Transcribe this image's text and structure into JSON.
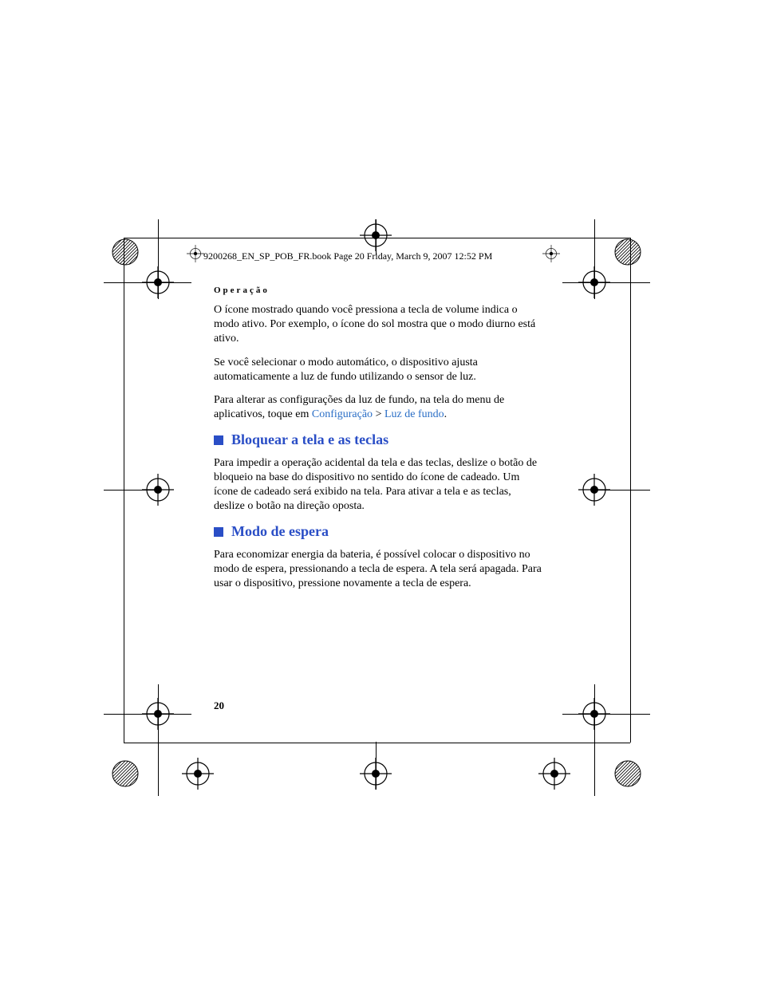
{
  "header_line": "9200268_EN_SP_POB_FR.book  Page 20  Friday, March 9, 2007  12:52 PM",
  "section_label": "Operação",
  "para1": "O ícone mostrado quando você pressiona a tecla de volume indica o modo ativo. Por exemplo, o ícone do sol mostra que o modo diurno está ativo.",
  "para2": "Se você selecionar o modo automático, o dispositivo ajusta automaticamente a luz de fundo utilizando o sensor de luz.",
  "para3_a": "Para alterar as configurações da luz de fundo, na tela do menu de aplicativos, toque em ",
  "para3_link1": "Configuração",
  "para3_sep": " > ",
  "para3_link2": "Luz de fundo",
  "para3_end": ".",
  "heading1": "Bloquear a tela e as teclas",
  "para4": "Para impedir a operação acidental da tela e das teclas, deslize o botão de bloqueio na base do dispositivo no sentido do ícone de cadeado. Um ícone de cadeado será exibido na tela. Para ativar a tela e as teclas, deslize o botão na direção oposta.",
  "heading2": "Modo de espera",
  "para5": "Para economizar energia da bateria, é possível colocar o dispositivo no modo de espera, pressionando a tecla de espera. A tela será apagada. Para usar o dispositivo, pressione novamente a tecla de espera.",
  "page_number": "20"
}
